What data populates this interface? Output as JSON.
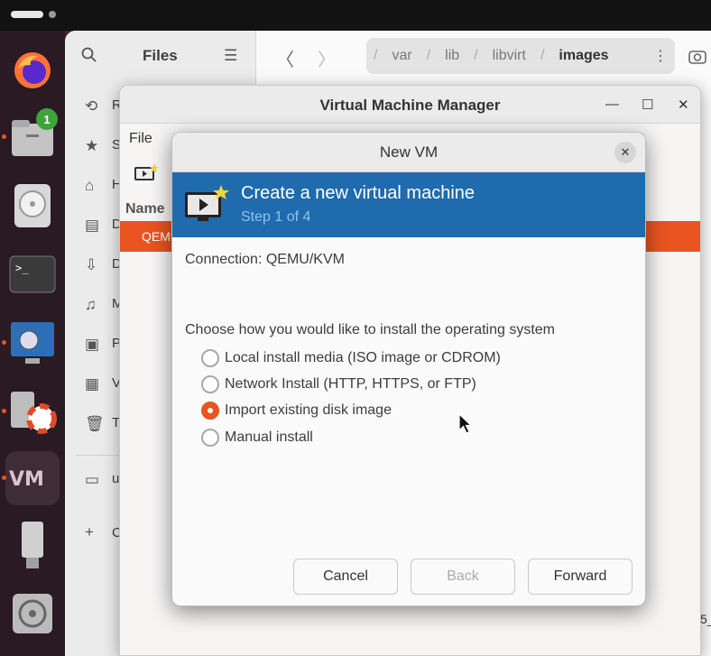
{
  "files": {
    "title": "Files",
    "path": [
      "var",
      "lib",
      "libvirt",
      "images"
    ],
    "sidebar": [
      {
        "icon": "clock-icon",
        "label": "R"
      },
      {
        "icon": "star-icon",
        "label": "S"
      },
      {
        "icon": "home-icon",
        "label": "H"
      },
      {
        "icon": "document-icon",
        "label": "D"
      },
      {
        "icon": "download-icon",
        "label": "D"
      },
      {
        "icon": "music-icon",
        "label": "M"
      },
      {
        "icon": "image-icon",
        "label": "P"
      },
      {
        "icon": "video-icon",
        "label": "V"
      },
      {
        "icon": "trash-icon",
        "label": "T"
      },
      {
        "icon": "drive-icon",
        "label": "u"
      },
      {
        "icon": "plus-icon",
        "label": "C"
      }
    ]
  },
  "dock": {
    "badge_count": "1"
  },
  "vmm": {
    "title": "Virtual Machine Manager",
    "menu_file": "File",
    "column_name": "Name",
    "row_text": "QEMU"
  },
  "dialog": {
    "title": "New VM",
    "banner_title": "Create a new virtual machine",
    "banner_step": "Step 1 of 4",
    "connection": "Connection:  QEMU/KVM",
    "prompt": "Choose how you would like to install the operating system",
    "options": [
      {
        "label": "Local install media (ISO image or CDROM)",
        "selected": false
      },
      {
        "label": "Network Install (HTTP, HTTPS, or FTP)",
        "selected": false
      },
      {
        "label": "Import existing disk image",
        "selected": true
      },
      {
        "label": "Manual install",
        "selected": false
      }
    ],
    "cancel_label": "Cancel",
    "back_label": "Back",
    "forward_label": "Forward"
  },
  "colors": {
    "accent": "#e95420",
    "banner": "#1f6bad"
  }
}
